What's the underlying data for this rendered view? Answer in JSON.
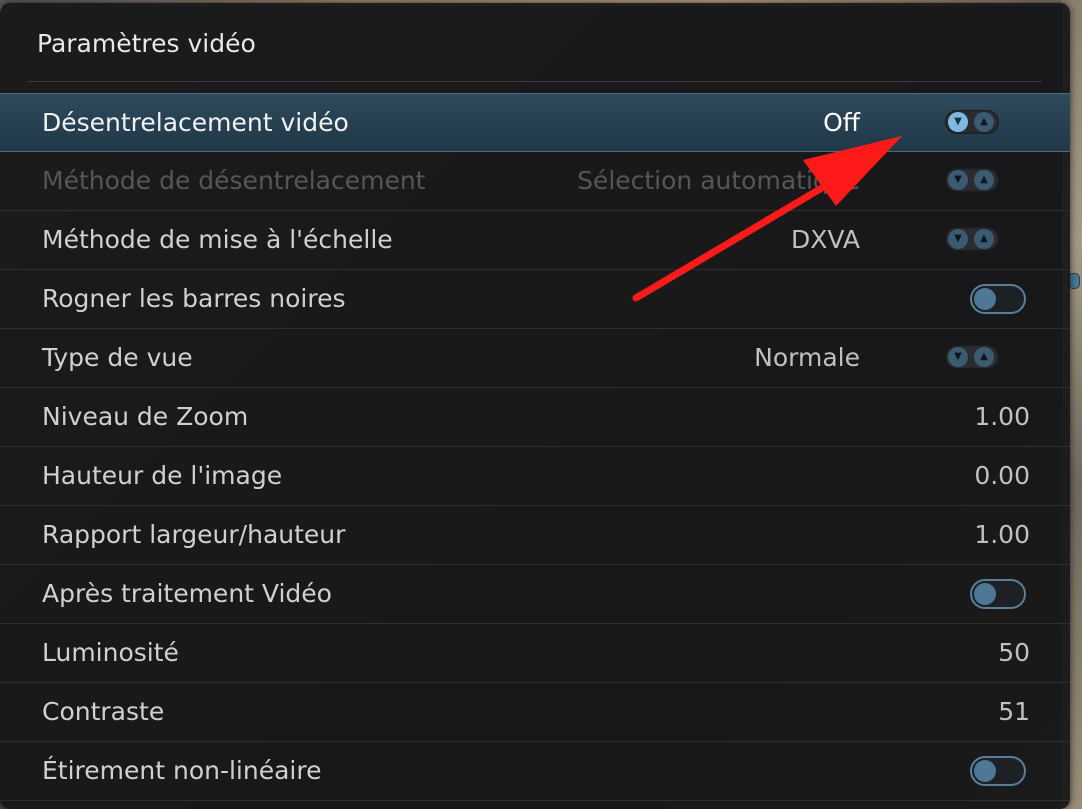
{
  "dialog": {
    "title": "Paramètres vidéo"
  },
  "settings": [
    {
      "label": "Désentrelacement vidéo",
      "value": "Off",
      "control": "spinner",
      "state": "selected"
    },
    {
      "label": "Méthode de désentrelacement",
      "value": "Sélection automatique",
      "control": "spinner",
      "state": "disabled"
    },
    {
      "label": "Méthode de mise à l'échelle",
      "value": "DXVA",
      "control": "spinner",
      "state": "normal"
    },
    {
      "label": "Rogner les barres noires",
      "value": "",
      "control": "toggle",
      "toggle_on": false,
      "state": "normal"
    },
    {
      "label": "Type de vue",
      "value": "Normale",
      "control": "spinner",
      "state": "normal"
    },
    {
      "label": "Niveau de Zoom",
      "value": "1.00",
      "control": "none",
      "state": "normal"
    },
    {
      "label": "Hauteur de l'image",
      "value": "0.00",
      "control": "none",
      "state": "normal"
    },
    {
      "label": "Rapport largeur/hauteur",
      "value": "1.00",
      "control": "none",
      "state": "normal"
    },
    {
      "label": "Après traitement Vidéo",
      "value": "",
      "control": "toggle",
      "toggle_on": false,
      "state": "normal"
    },
    {
      "label": "Luminosité",
      "value": "50",
      "control": "none",
      "state": "normal"
    },
    {
      "label": "Contraste",
      "value": "51",
      "control": "none",
      "state": "normal"
    },
    {
      "label": "Étirement non-linéaire",
      "value": "",
      "control": "toggle",
      "toggle_on": false,
      "state": "normal"
    }
  ],
  "icons": {
    "spinner_down": "chevron-down-icon",
    "spinner_up": "chevron-up-icon",
    "spinner_down_glyph": "▼",
    "spinner_up_glyph": "▲"
  },
  "colors": {
    "selected_row": "#2f4a5c",
    "accent": "#7fb8e0",
    "annotation_arrow": "#ff1a1a"
  }
}
